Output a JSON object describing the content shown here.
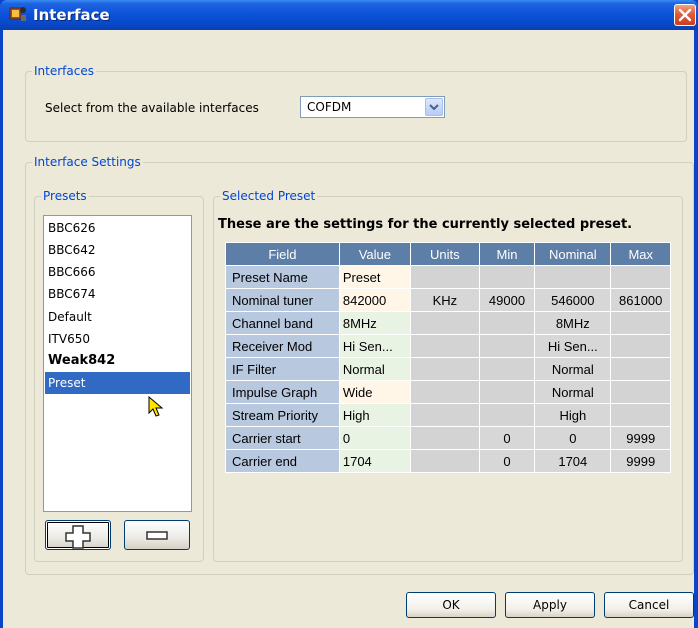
{
  "window": {
    "title": "Interface"
  },
  "interfaces": {
    "legend": "Interfaces",
    "select_label": "Select from the available interfaces",
    "selected_interface": "COFDM"
  },
  "settings": {
    "legend": "Interface Settings",
    "presets": {
      "legend": "Presets",
      "items": [
        {
          "label": "BBC626",
          "bold": false,
          "selected": false
        },
        {
          "label": "BBC642",
          "bold": false,
          "selected": false
        },
        {
          "label": "BBC666",
          "bold": false,
          "selected": false
        },
        {
          "label": "BBC674",
          "bold": false,
          "selected": false
        },
        {
          "label": "Default",
          "bold": false,
          "selected": false
        },
        {
          "label": "ITV650",
          "bold": false,
          "selected": false
        },
        {
          "label": "Weak842",
          "bold": true,
          "selected": false
        },
        {
          "label": "Preset",
          "bold": false,
          "selected": true
        }
      ]
    },
    "selected_preset": {
      "legend": "Selected Preset",
      "caption": "These are the settings for the currently selected preset.",
      "columns": [
        "Field",
        "Value",
        "Units",
        "Min",
        "Nominal",
        "Max"
      ],
      "rows": [
        {
          "field": "Preset Name",
          "value": "Preset",
          "units": "",
          "min": "",
          "nominal": "",
          "max": "",
          "value_bg": "#fff6e8"
        },
        {
          "field": "Nominal tuner",
          "value": "842000",
          "units": "KHz",
          "min": "49000",
          "nominal": "546000",
          "max": "861000",
          "value_bg": "#fff6e8"
        },
        {
          "field": "Channel band",
          "value": "8MHz",
          "units": "",
          "min": "",
          "nominal": "8MHz",
          "max": "",
          "value_bg": "#e9f3e4"
        },
        {
          "field": "Receiver Mod",
          "value": "Hi Sen...",
          "units": "",
          "min": "",
          "nominal": "Hi Sen...",
          "max": "",
          "value_bg": "#e9f3e4"
        },
        {
          "field": "IF Filter",
          "value": "Normal",
          "units": "",
          "min": "",
          "nominal": "Normal",
          "max": "",
          "value_bg": "#e9f3e4"
        },
        {
          "field": "Impulse Graph",
          "value": "Wide",
          "units": "",
          "min": "",
          "nominal": "Normal",
          "max": "",
          "value_bg": "#fff6e8"
        },
        {
          "field": "Stream Priority",
          "value": "High",
          "units": "",
          "min": "",
          "nominal": "High",
          "max": "",
          "value_bg": "#e9f3e4"
        },
        {
          "field": "Carrier start",
          "value": "0",
          "units": "",
          "min": "0",
          "nominal": "0",
          "max": "9999",
          "value_bg": "#e9f3e4"
        },
        {
          "field": "Carrier end",
          "value": "1704",
          "units": "",
          "min": "0",
          "nominal": "1704",
          "max": "9999",
          "value_bg": "#e9f3e4"
        }
      ]
    }
  },
  "buttons": {
    "ok": "OK",
    "apply": "Apply",
    "cancel": "Cancel"
  },
  "icons": {
    "app": "app-icon",
    "close": "close-icon",
    "dropdown": "chevron-down-icon",
    "add": "plus-icon",
    "remove": "minus-icon",
    "cursor": "mouse-pointer-icon"
  },
  "colors": {
    "title_bar": "#0b51d8",
    "accent_text": "#0046d5",
    "selection": "#316ac5",
    "table_header": "#5d7ea7",
    "table_field": "#b7c8df"
  }
}
